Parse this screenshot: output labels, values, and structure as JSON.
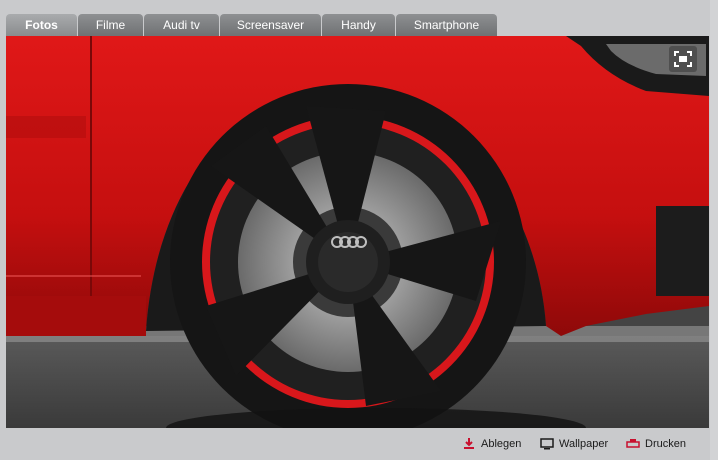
{
  "tabs": [
    {
      "label": "Fotos",
      "active": true
    },
    {
      "label": "Filme"
    },
    {
      "label": "Audi tv"
    },
    {
      "label": "Screensaver"
    },
    {
      "label": "Handy"
    },
    {
      "label": "Smartphone"
    }
  ],
  "viewer": {
    "fullscreen_icon": "fullscreen-icon"
  },
  "actions": {
    "save_label": "Ablegen",
    "wallpaper_label": "Wallpaper",
    "print_label": "Drucken"
  },
  "colors": {
    "car_red": "#d41414",
    "accent_red": "#c8102e",
    "tab_gray": "#7b7d80"
  }
}
